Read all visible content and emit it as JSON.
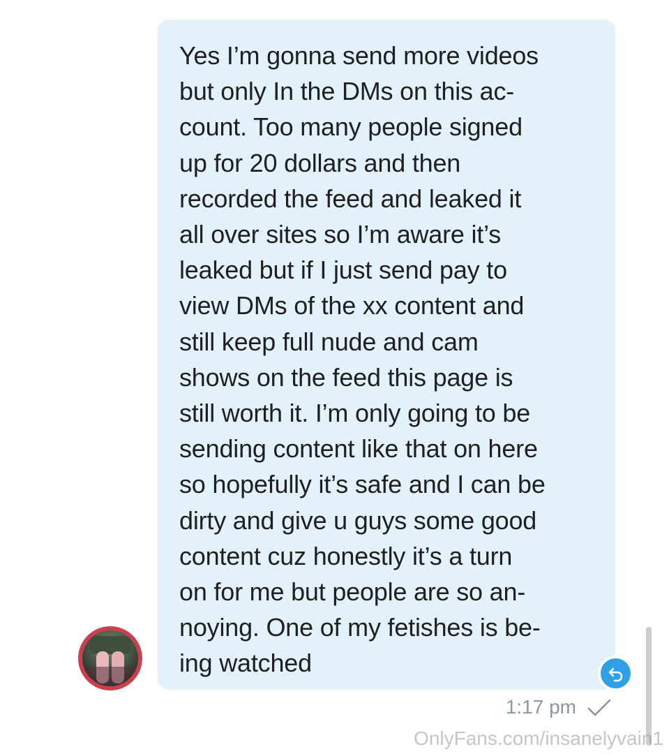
{
  "message": {
    "lines": [
      "Yes I’m gonna send more videos",
      "but only In the DMs on this ac-",
      "count. Too many people signed",
      "up for 20 dollars and then",
      "recorded the feed and leaked it",
      "all over sites so I’m aware it’s",
      "leaked but if I just send pay to",
      "view DMs of the xx content and",
      "still keep full nude and cam",
      "shows on the feed this page is",
      "still worth it. I’m only going to be",
      "sending content like that on here",
      "so hopefully it’s safe and I can be",
      "dirty and give u guys some good",
      "content cuz honestly it’s a turn",
      "on for me but people are so an-",
      "noying. One of my fetishes is be-",
      "ing watched"
    ],
    "time": "1:17 pm",
    "status_icon": "checkmark-icon",
    "reply_icon": "reply-icon",
    "bubble_color": "#e3f1fb",
    "accent_color": "#2ea0e6"
  },
  "watermark": "OnlyFans.com/insanelyvain1"
}
